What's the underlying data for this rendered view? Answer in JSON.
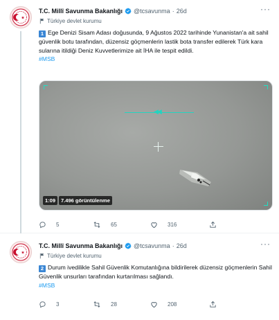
{
  "tweets": [
    {
      "author_name": "T.C. Millî Savunma Bakanlığı",
      "handle": "@tcsavunma",
      "separator": "·",
      "time": "26d",
      "account_label": "Türkiye devlet kurumu",
      "number_badge": "1",
      "text": "Ege Denizi Sisam Adası doğusunda, 9 Ağustos 2022 tarihinde Yunanistan'a ait sahil güvenlik botu tarafından, düzensiz göçmenlerin lastik bota transfer edilerek Türk kara sularına itildiği Deniz Kuvvetlerimize ait İHA ile tespit edildi.",
      "hashtag": "#MSB",
      "video": {
        "duration": "1:09",
        "views": "7.496 görüntülenme"
      },
      "replies": "5",
      "retweets": "65",
      "likes": "316"
    },
    {
      "author_name": "T.C. Millî Savunma Bakanlığı",
      "handle": "@tcsavunma",
      "separator": "·",
      "time": "26d",
      "account_label": "Türkiye devlet kurumu",
      "number_badge": "2",
      "text": "Durum ivedilikle Sahil Güvenlik Komutanlığına bildirilerek düzensiz göçmenlerin Sahil Güvenlik unsurları tarafından kurtarılması sağlandı.",
      "hashtag": "#MSB",
      "replies": "3",
      "retweets": "28",
      "likes": "208"
    }
  ],
  "more_menu": "···",
  "colors": {
    "accent": "#1d9bf0",
    "muted": "#536471",
    "hud": "#22d4c0",
    "badge": "#3a86d4",
    "avatar_red": "#c8102e"
  },
  "icons": [
    "avatar-emblem-icon",
    "verified-badge-icon",
    "government-flag-icon",
    "reply-icon",
    "retweet-icon",
    "like-icon",
    "share-icon",
    "more-icon"
  ]
}
